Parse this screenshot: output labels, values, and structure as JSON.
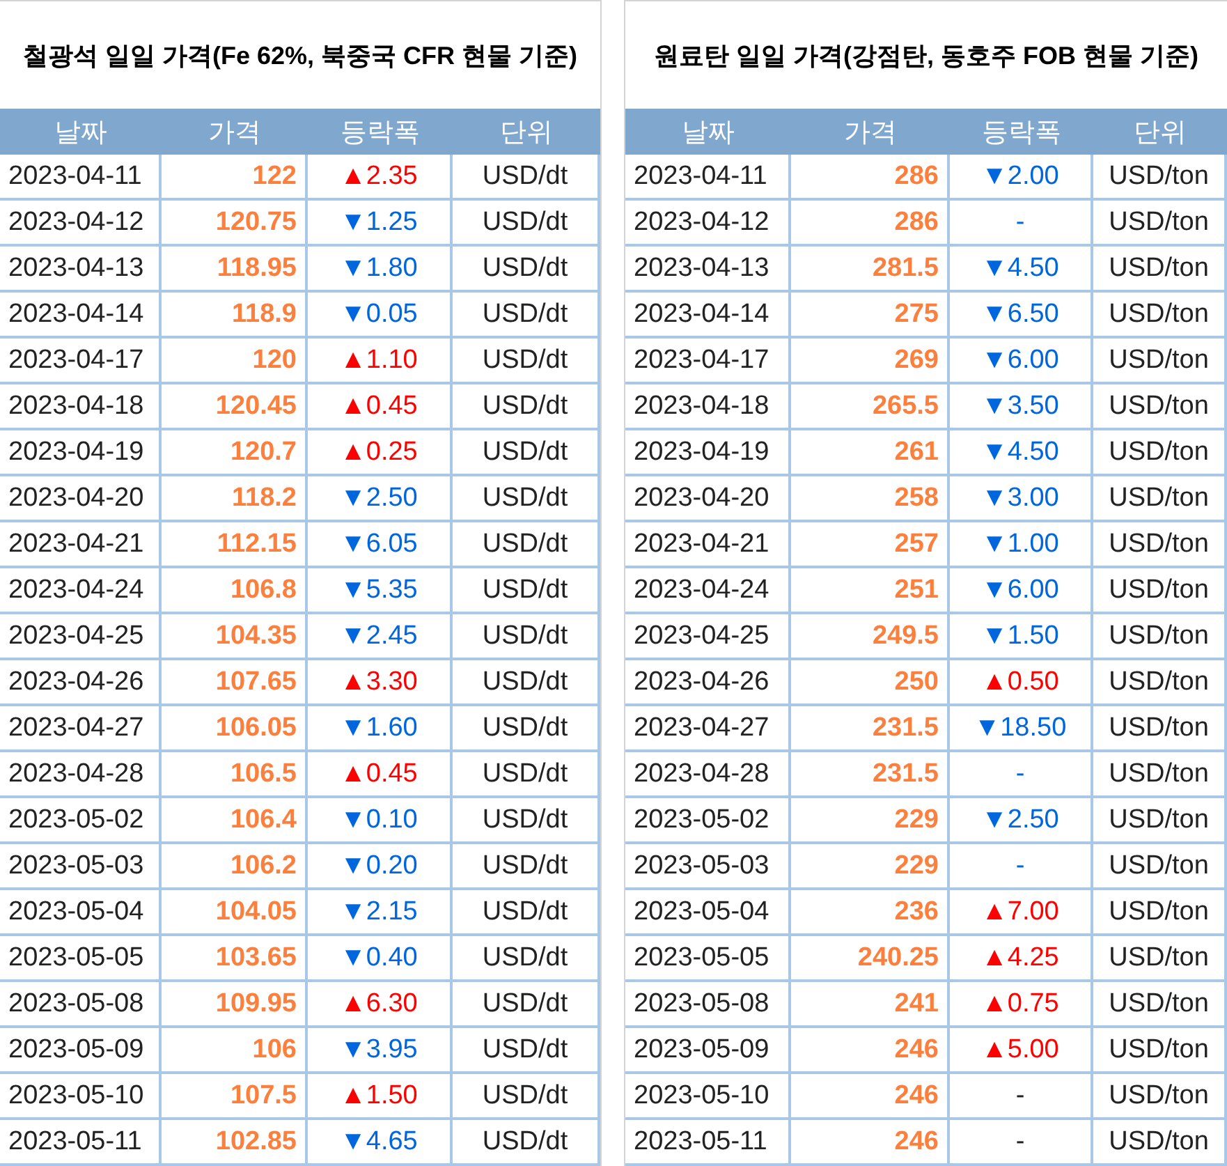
{
  "tables": [
    {
      "title": "철광석 일일 가격(Fe 62%, 북중국 CFR 현물 기준)",
      "columns": [
        "날짜",
        "가격",
        "등락폭",
        "단위"
      ],
      "rows": [
        {
          "date": "2023-04-11",
          "price": "122",
          "change": "▲2.35",
          "kind": "up",
          "unit": "USD/dt"
        },
        {
          "date": "2023-04-12",
          "price": "120.75",
          "change": "▼1.25",
          "kind": "down",
          "unit": "USD/dt"
        },
        {
          "date": "2023-04-13",
          "price": "118.95",
          "change": "▼1.80",
          "kind": "down",
          "unit": "USD/dt"
        },
        {
          "date": "2023-04-14",
          "price": "118.9",
          "change": "▼0.05",
          "kind": "down",
          "unit": "USD/dt"
        },
        {
          "date": "2023-04-17",
          "price": "120",
          "change": "▲1.10",
          "kind": "up",
          "unit": "USD/dt"
        },
        {
          "date": "2023-04-18",
          "price": "120.45",
          "change": "▲0.45",
          "kind": "up",
          "unit": "USD/dt"
        },
        {
          "date": "2023-04-19",
          "price": "120.7",
          "change": "▲0.25",
          "kind": "up",
          "unit": "USD/dt"
        },
        {
          "date": "2023-04-20",
          "price": "118.2",
          "change": "▼2.50",
          "kind": "down",
          "unit": "USD/dt"
        },
        {
          "date": "2023-04-21",
          "price": "112.15",
          "change": "▼6.05",
          "kind": "down",
          "unit": "USD/dt"
        },
        {
          "date": "2023-04-24",
          "price": "106.8",
          "change": "▼5.35",
          "kind": "down",
          "unit": "USD/dt"
        },
        {
          "date": "2023-04-25",
          "price": "104.35",
          "change": "▼2.45",
          "kind": "down",
          "unit": "USD/dt"
        },
        {
          "date": "2023-04-26",
          "price": "107.65",
          "change": "▲3.30",
          "kind": "up",
          "unit": "USD/dt"
        },
        {
          "date": "2023-04-27",
          "price": "106.05",
          "change": "▼1.60",
          "kind": "down",
          "unit": "USD/dt"
        },
        {
          "date": "2023-04-28",
          "price": "106.5",
          "change": "▲0.45",
          "kind": "up",
          "unit": "USD/dt"
        },
        {
          "date": "2023-05-02",
          "price": "106.4",
          "change": "▼0.10",
          "kind": "down",
          "unit": "USD/dt"
        },
        {
          "date": "2023-05-03",
          "price": "106.2",
          "change": "▼0.20",
          "kind": "down",
          "unit": "USD/dt"
        },
        {
          "date": "2023-05-04",
          "price": "104.05",
          "change": "▼2.15",
          "kind": "down",
          "unit": "USD/dt"
        },
        {
          "date": "2023-05-05",
          "price": "103.65",
          "change": "▼0.40",
          "kind": "down",
          "unit": "USD/dt"
        },
        {
          "date": "2023-05-08",
          "price": "109.95",
          "change": "▲6.30",
          "kind": "up",
          "unit": "USD/dt"
        },
        {
          "date": "2023-05-09",
          "price": "106",
          "change": "▼3.95",
          "kind": "down",
          "unit": "USD/dt"
        },
        {
          "date": "2023-05-10",
          "price": "107.5",
          "change": "▲1.50",
          "kind": "up",
          "unit": "USD/dt"
        },
        {
          "date": "2023-05-11",
          "price": "102.85",
          "change": "▼4.65",
          "kind": "down",
          "unit": "USD/dt"
        }
      ]
    },
    {
      "title": "원료탄 일일 가격(강점탄, 동호주 FOB 현물 기준)",
      "columns": [
        "날짜",
        "가격",
        "등락폭",
        "단위"
      ],
      "rows": [
        {
          "date": "2023-04-11",
          "price": "286",
          "change": "▼2.00",
          "kind": "down",
          "unit": "USD/ton"
        },
        {
          "date": "2023-04-12",
          "price": "286",
          "change": "-",
          "kind": "down",
          "unit": "USD/ton"
        },
        {
          "date": "2023-04-13",
          "price": "281.5",
          "change": "▼4.50",
          "kind": "down",
          "unit": "USD/ton"
        },
        {
          "date": "2023-04-14",
          "price": "275",
          "change": "▼6.50",
          "kind": "down",
          "unit": "USD/ton"
        },
        {
          "date": "2023-04-17",
          "price": "269",
          "change": "▼6.00",
          "kind": "down",
          "unit": "USD/ton"
        },
        {
          "date": "2023-04-18",
          "price": "265.5",
          "change": "▼3.50",
          "kind": "down",
          "unit": "USD/ton"
        },
        {
          "date": "2023-04-19",
          "price": "261",
          "change": "▼4.50",
          "kind": "down",
          "unit": "USD/ton"
        },
        {
          "date": "2023-04-20",
          "price": "258",
          "change": "▼3.00",
          "kind": "down",
          "unit": "USD/ton"
        },
        {
          "date": "2023-04-21",
          "price": "257",
          "change": "▼1.00",
          "kind": "down",
          "unit": "USD/ton"
        },
        {
          "date": "2023-04-24",
          "price": "251",
          "change": "▼6.00",
          "kind": "down",
          "unit": "USD/ton"
        },
        {
          "date": "2023-04-25",
          "price": "249.5",
          "change": "▼1.50",
          "kind": "down",
          "unit": "USD/ton"
        },
        {
          "date": "2023-04-26",
          "price": "250",
          "change": "▲0.50",
          "kind": "up",
          "unit": "USD/ton"
        },
        {
          "date": "2023-04-27",
          "price": "231.5",
          "change": "▼18.50",
          "kind": "down",
          "unit": "USD/ton"
        },
        {
          "date": "2023-04-28",
          "price": "231.5",
          "change": "-",
          "kind": "down",
          "unit": "USD/ton"
        },
        {
          "date": "2023-05-02",
          "price": "229",
          "change": "▼2.50",
          "kind": "down",
          "unit": "USD/ton"
        },
        {
          "date": "2023-05-03",
          "price": "229",
          "change": "-",
          "kind": "down",
          "unit": "USD/ton"
        },
        {
          "date": "2023-05-04",
          "price": "236",
          "change": "▲7.00",
          "kind": "up",
          "unit": "USD/ton"
        },
        {
          "date": "2023-05-05",
          "price": "240.25",
          "change": "▲4.25",
          "kind": "up",
          "unit": "USD/ton"
        },
        {
          "date": "2023-05-08",
          "price": "241",
          "change": "▲0.75",
          "kind": "up",
          "unit": "USD/ton"
        },
        {
          "date": "2023-05-09",
          "price": "246",
          "change": "▲5.00",
          "kind": "up",
          "unit": "USD/ton"
        },
        {
          "date": "2023-05-10",
          "price": "246",
          "change": "-",
          "kind": "none",
          "unit": "USD/ton"
        },
        {
          "date": "2023-05-11",
          "price": "246",
          "change": "-",
          "kind": "none",
          "unit": "USD/ton"
        }
      ]
    }
  ]
}
